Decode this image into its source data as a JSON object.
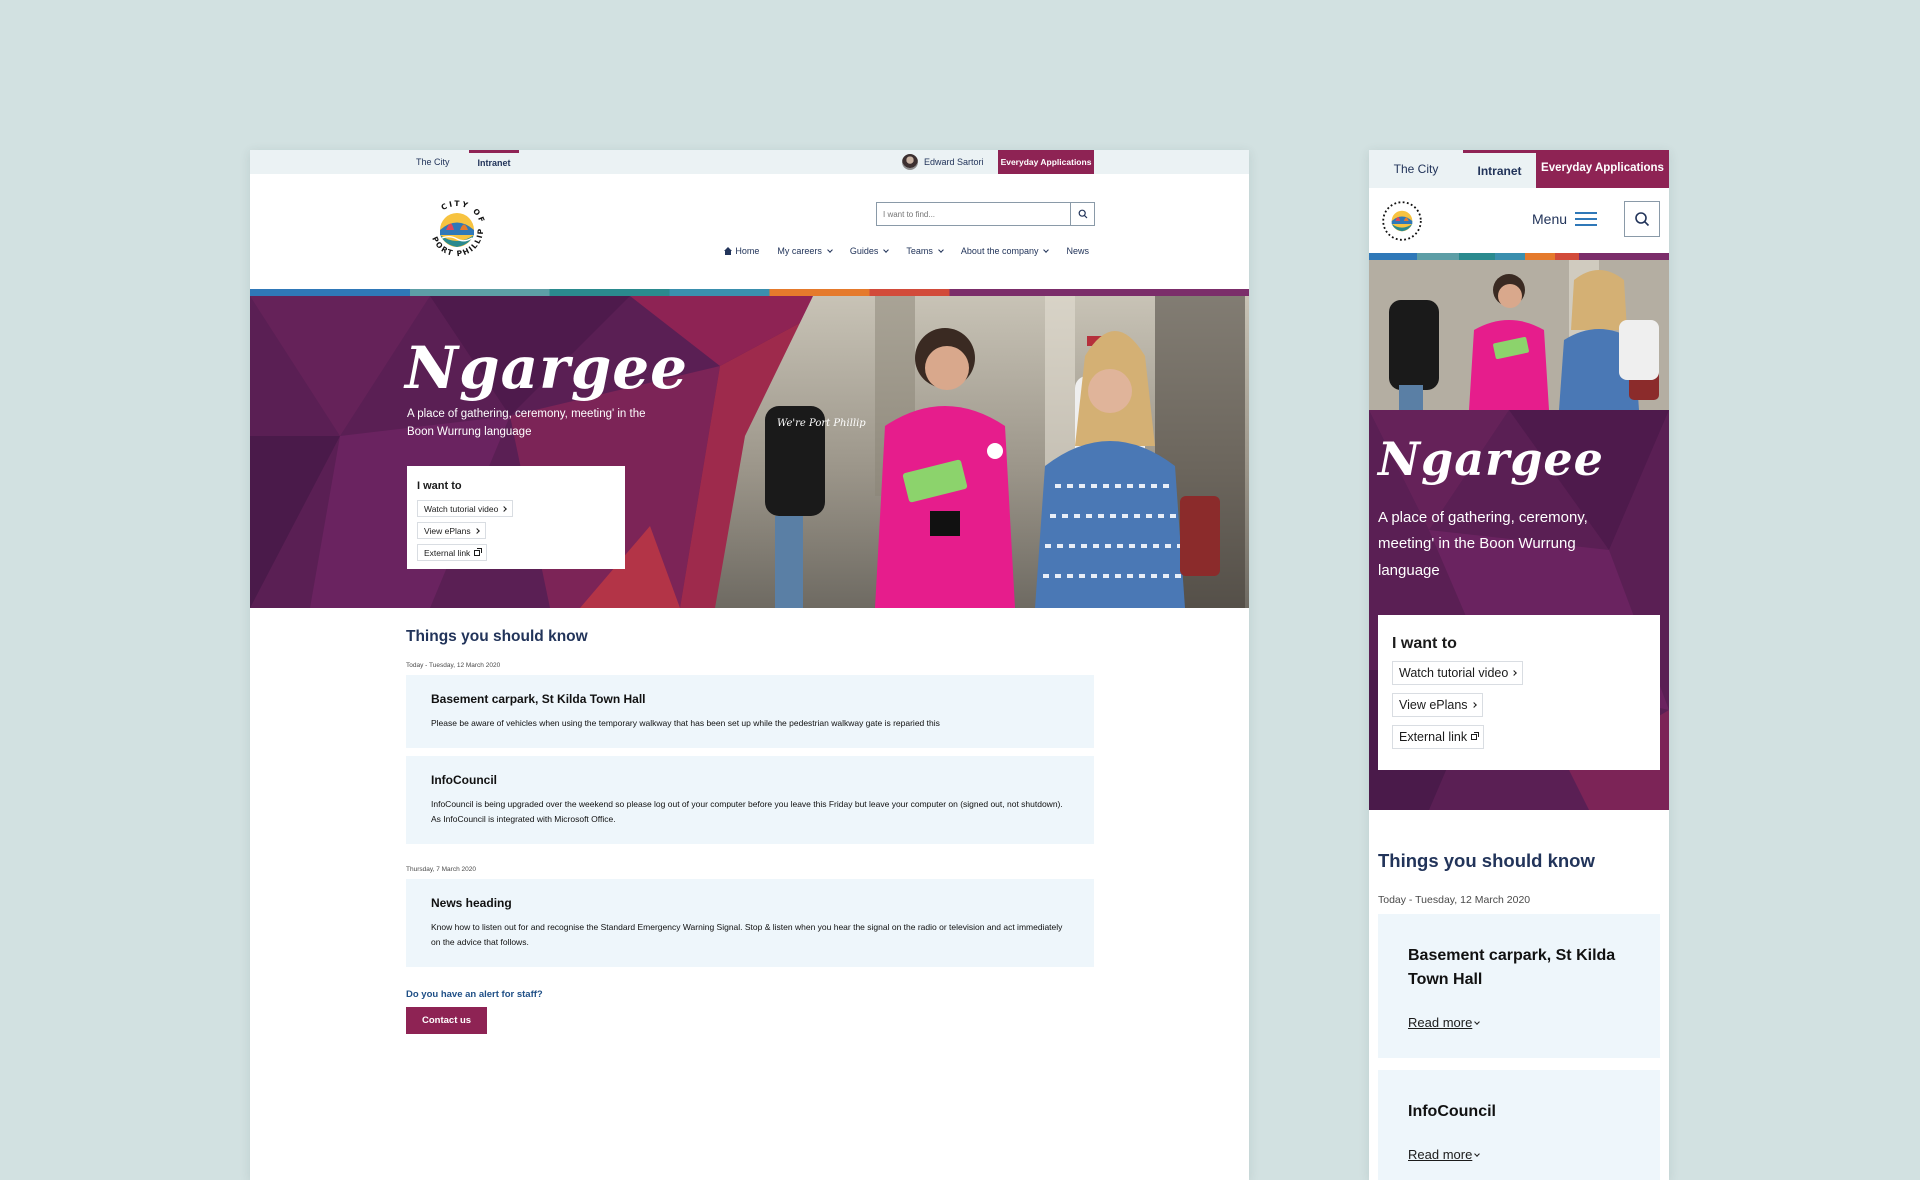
{
  "util": {
    "tab_city": "The City",
    "tab_intranet": "Intranet",
    "user_name": "Edward Sartori",
    "everyday_apps": "Everyday Applications"
  },
  "logo": {
    "text": "CITY OF PORT PHILLIP"
  },
  "search": {
    "placeholder": "I want to find..."
  },
  "nav": {
    "home": "Home",
    "careers": "My careers",
    "guides": "Guides",
    "teams": "Teams",
    "about": "About the company",
    "news": "News"
  },
  "hero": {
    "title": "Ngargee",
    "subtitle": "A place of gathering, ceremony, meeting' in the Boon Wurrung language",
    "i_want_title": "I want to",
    "links": [
      "Watch tutorial video",
      "View ePlans",
      "External link"
    ],
    "shirt_text": "We're Port Phillip"
  },
  "mobile": {
    "menu_label": "Menu",
    "read_more": "Read more"
  },
  "content": {
    "section_title": "Things you should know",
    "groups": [
      {
        "date": "Today - Tuesday, 12 March 2020",
        "items": [
          {
            "title": "Basement carpark, St Kilda Town Hall",
            "body": "Please be aware of vehicles when using the temporary walkway that has been set up while the pedestrian walkway gate is reparied this"
          },
          {
            "title": "InfoCouncil",
            "body": "InfoCouncil is being upgraded over the weekend so please log out of your computer before you leave this Friday but leave your computer on (signed out, not shutdown). As InfoCouncil is integrated with Microsoft Office."
          }
        ]
      },
      {
        "date": "Thursday, 7 March 2020",
        "items": [
          {
            "title": "News heading",
            "body": "Know how to listen out for and recognise the Standard Emergency Warning Signal. Stop & listen when you hear the signal on the radio or television and act immediately on the advice that follows."
          }
        ]
      }
    ],
    "alert_question": "Do you have an alert for staff?",
    "contact_button": "Contact us"
  },
  "icons": {
    "search": "search-icon",
    "home": "home-icon",
    "menu": "menu-icon",
    "chevron": "chevron-icon",
    "external": "external-link-icon"
  },
  "colors": {
    "brand": "#8e2354",
    "navy": "#22345a",
    "hero_purple": "#5a1f54",
    "card_bg": "#eef6fb",
    "page_bg": "#d2e1e1"
  }
}
